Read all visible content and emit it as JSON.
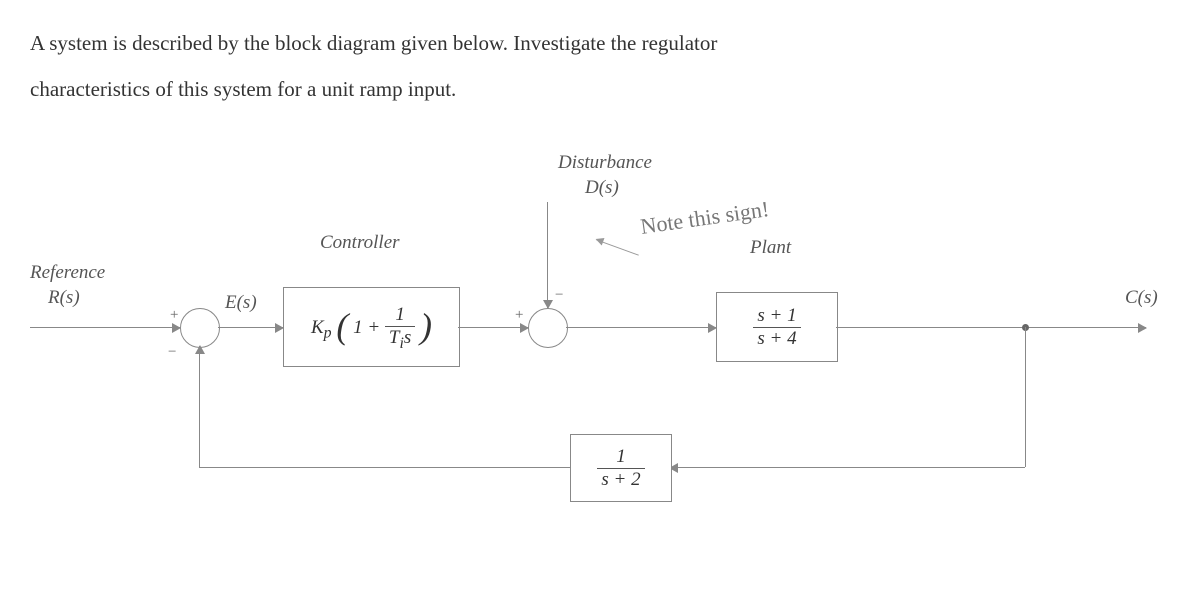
{
  "problem": {
    "line1": "A system is described by the block diagram given below. Investigate the regulator",
    "line2": "characteristics of this system for a unit ramp input."
  },
  "labels": {
    "reference": "Reference",
    "r_s": "R(s)",
    "e_s": "E(s)",
    "controller": "Controller",
    "disturbance": "Disturbance",
    "d_s": "D(s)",
    "plant": "Plant",
    "c_s": "C(s)",
    "note": "Note this sign!"
  },
  "blocks": {
    "controller": {
      "Kp": "K",
      "Kp_sub": "p",
      "inner_num": "1",
      "inner_den_a": "T",
      "inner_den_sub": "i",
      "inner_den_b": "s",
      "plus": "1 +"
    },
    "plant": {
      "num": "s + 1",
      "den": "s + 4"
    },
    "feedback": {
      "num": "1",
      "den": "s + 2"
    }
  },
  "signs": {
    "sum1_plus": "+",
    "sum1_minus": "−",
    "sum2_plus": "+",
    "sum2_minus": "−"
  }
}
